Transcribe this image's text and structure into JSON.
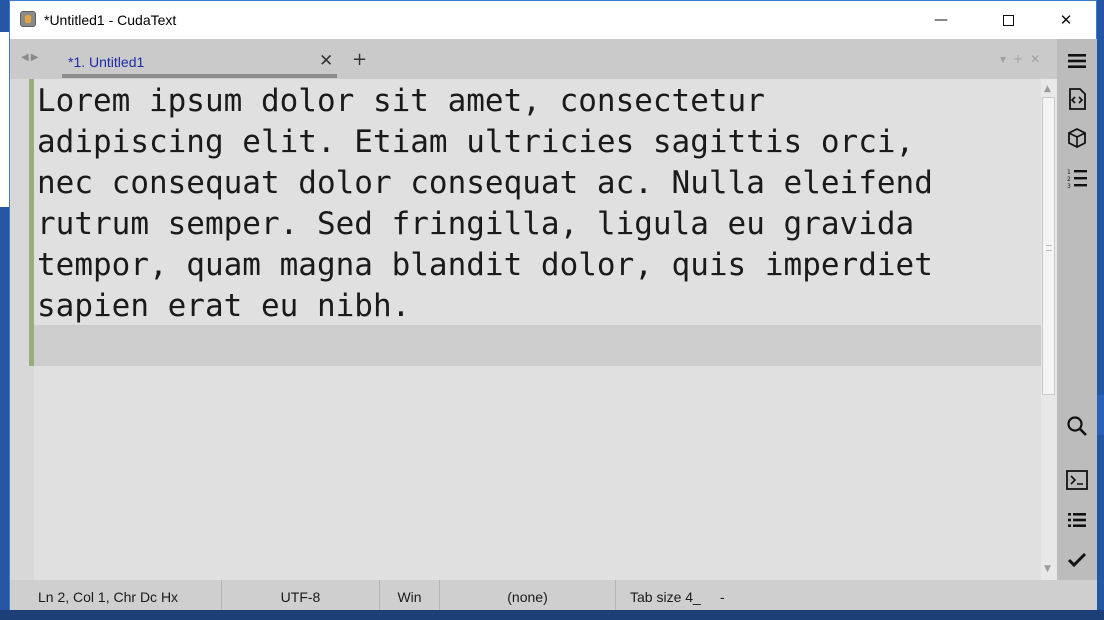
{
  "window": {
    "title": "*Untitled1 - CudaText"
  },
  "titlebar_buttons": {
    "minimize": "—",
    "close": "✕"
  },
  "tabs": [
    {
      "label": "*1. Untitled1",
      "close": "✕"
    }
  ],
  "tabbar": {
    "add": "+",
    "right_controls": "▾+✕"
  },
  "editor": {
    "lines": [
      "Lorem ipsum dolor sit amet, consectetur",
      "adipiscing elit. Etiam ultricies sagittis orci,",
      "nec consequat dolor consequat ac. Nulla eleifend",
      "rutrum semper. Sed fringilla, ligula eu gravida",
      "tempor, quam magna blandit dolor, quis imperdiet",
      "sapien erat eu nibh."
    ]
  },
  "sidebar": {
    "icons": [
      "menu-icon",
      "code-tree-icon",
      "project-icon",
      "numbered-list-icon",
      "search-icon",
      "console-icon",
      "output-list-icon",
      "validate-icon"
    ]
  },
  "statusbar": {
    "position": "Ln 2, Col 1, Chr  Dc  Hx",
    "encoding": "UTF-8",
    "line_ending": "Win",
    "lexer": "(none)",
    "tab_size": "Tab size 4_",
    "extra": "-"
  },
  "colors": {
    "accent": "#1f2aa8",
    "editor_bg": "#e0e0e0",
    "current_line": "#cdcdcd",
    "modified_gutter": "#96ad7c",
    "sidebar_bg": "#bcbcbc"
  }
}
